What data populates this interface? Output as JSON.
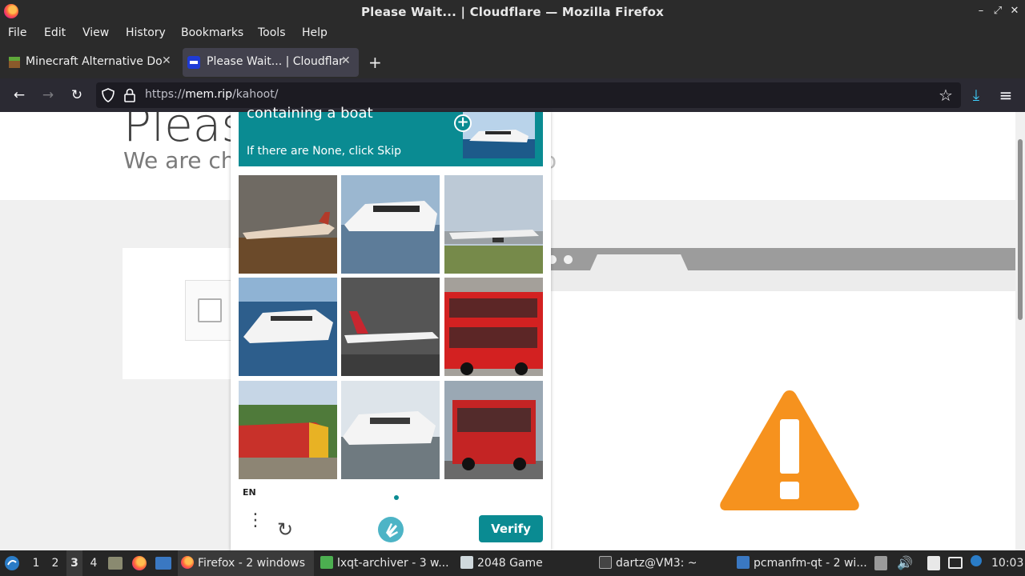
{
  "window": {
    "title": "Please Wait... | Cloudflare — Mozilla Firefox",
    "min_glyph": "–",
    "max_glyph": "⤢",
    "close_glyph": "✕"
  },
  "menu": {
    "file": "File",
    "edit": "Edit",
    "view": "View",
    "history": "History",
    "bookmarks": "Bookmarks",
    "tools": "Tools",
    "help": "Help"
  },
  "tabs": [
    {
      "label": "Minecraft Alternative Do",
      "close": "✕"
    },
    {
      "label": "Please Wait... | Cloudflare",
      "close": "✕"
    }
  ],
  "newtab": "+",
  "nav": {
    "back": "←",
    "forward": "→",
    "reload": "↻",
    "url_prefix": "https://",
    "url_host": "mem.rip",
    "url_path": "/kahoot/",
    "star": "☆",
    "download": "⤓",
    "menu": "≡"
  },
  "page": {
    "title": "Pleas",
    "subtitle": "We are ch",
    "subtitle_tail": "o"
  },
  "captcha": {
    "prompt": "containing a boat",
    "instruction": "If there are None, click Skip",
    "language": "EN",
    "verify": "Verify",
    "refresh": "↻",
    "menu_dots": "⋮",
    "grid": [
      "airplane",
      "boat",
      "airplane",
      "boat",
      "airplane",
      "bus",
      "train",
      "boat",
      "bus"
    ]
  },
  "taskbar": {
    "workspaces": [
      "1",
      "2",
      "3",
      "4"
    ],
    "active_workspace": "3",
    "tasks": [
      "Firefox - 2 windows",
      "lxqt-archiver - 3 w...",
      "2048 Game",
      "dartz@VM3: ~",
      "pcmanfm-qt - 2 wi..."
    ],
    "clock": "10:03"
  },
  "colors": {
    "captcha_teal": "#0a8b92",
    "warning_orange": "#f6921e"
  }
}
